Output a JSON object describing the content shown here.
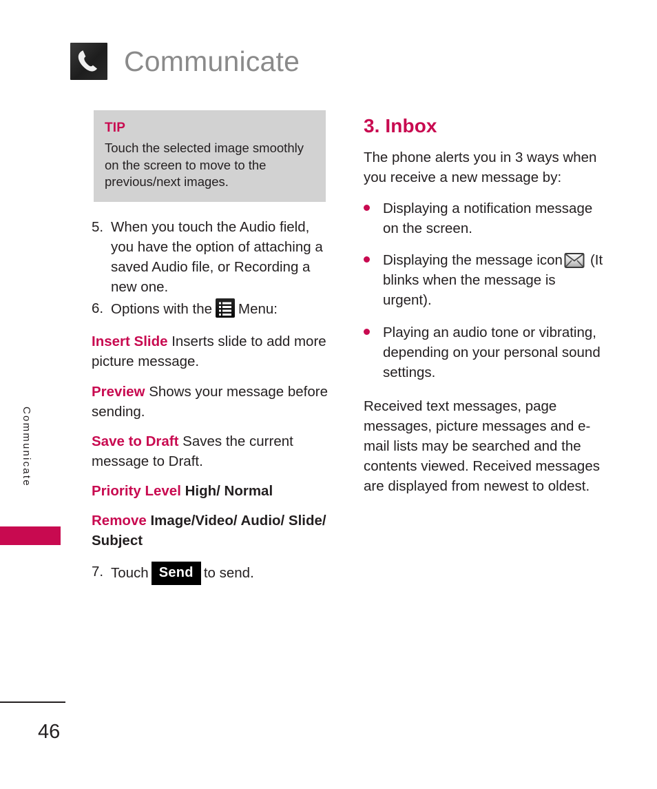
{
  "header": {
    "title": "Communicate",
    "icon": "phone-handset-icon"
  },
  "side_tab": {
    "label": "Communicate",
    "marker_color": "#c80a50"
  },
  "colors": {
    "accent": "#c80a50",
    "tip_background": "#d2d2d2",
    "body_text": "#231f20",
    "header_title": "#8a8a8a"
  },
  "left_column": {
    "tip": {
      "heading": "TIP",
      "body": "Touch the selected image smoothly on the screen to move to the previous/next images."
    },
    "steps": [
      {
        "number": "5.",
        "text": "When you touch the Audio field, you have the option of attaching a saved Audio file, or Recording a new one."
      }
    ],
    "step6": {
      "number": "6.",
      "text_before": "Options with the",
      "icon": "list-menu-icon",
      "text_after": "Menu:"
    },
    "options": [
      {
        "term": "Insert Slide",
        "description": " Inserts slide to add more picture message.",
        "bold_description": ""
      },
      {
        "term": "Preview",
        "description": " Shows your message before sending.",
        "bold_description": ""
      },
      {
        "term": "Save to Draft",
        "description": " Saves the current message to Draft.",
        "bold_description": ""
      },
      {
        "term": "Priority Level",
        "description": "",
        "bold_description": " High/ Normal"
      },
      {
        "term": "Remove",
        "description": "",
        "bold_description": " Image/Video/ Audio/ Slide/ Subject"
      }
    ],
    "step7": {
      "number": "7.",
      "text_before": "Touch",
      "button_label": "Send",
      "text_after": "to send."
    }
  },
  "right_column": {
    "heading": "3. Inbox",
    "intro": "The phone alerts you in 3 ways when you receive a new message by:",
    "bullets": [
      {
        "text_before": "Displaying a notification message on the screen.",
        "icon": "",
        "text_after": ""
      },
      {
        "text_before": "Displaying the message icon",
        "icon": "envelope-message-icon",
        "text_after": "(It blinks when the message is urgent)."
      },
      {
        "text_before": "Playing an audio tone or vibrating, depending on your personal sound settings.",
        "icon": "",
        "text_after": ""
      }
    ],
    "closing": "Received text messages, page messages, picture messages and e-mail lists may be searched and the contents viewed. Received messages are displayed from newest to oldest."
  },
  "footer": {
    "page_number": "46"
  }
}
